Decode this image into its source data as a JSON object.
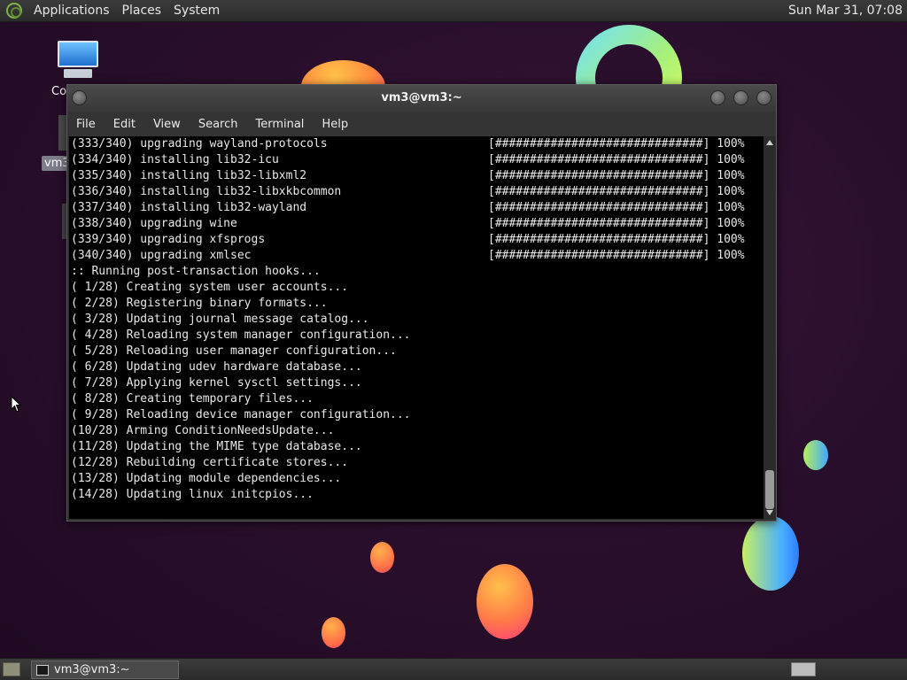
{
  "top_panel": {
    "menus": [
      "Applications",
      "Places",
      "System"
    ],
    "clock": "Sun Mar 31, 07:08"
  },
  "desktop": {
    "computer_label": "Co",
    "home_label": "vm3"
  },
  "terminal": {
    "title": "vm3@vm3:~",
    "menu": [
      "File",
      "Edit",
      "View",
      "Search",
      "Terminal",
      "Help"
    ],
    "lines": [
      {
        "text": "(333/340) upgrading wayland-protocols",
        "progress": "[##############################] 100%"
      },
      {
        "text": "(334/340) installing lib32-icu",
        "progress": "[##############################] 100%"
      },
      {
        "text": "(335/340) installing lib32-libxml2",
        "progress": "[##############################] 100%"
      },
      {
        "text": "(336/340) installing lib32-libxkbcommon",
        "progress": "[##############################] 100%"
      },
      {
        "text": "(337/340) installing lib32-wayland",
        "progress": "[##############################] 100%"
      },
      {
        "text": "(338/340) upgrading wine",
        "progress": "[##############################] 100%"
      },
      {
        "text": "(339/340) upgrading xfsprogs",
        "progress": "[##############################] 100%"
      },
      {
        "text": "(340/340) upgrading xmlsec",
        "progress": "[##############################] 100%"
      },
      {
        "text": ":: Running post-transaction hooks...",
        "progress": ""
      },
      {
        "text": "( 1/28) Creating system user accounts...",
        "progress": ""
      },
      {
        "text": "( 2/28) Registering binary formats...",
        "progress": ""
      },
      {
        "text": "( 3/28) Updating journal message catalog...",
        "progress": ""
      },
      {
        "text": "( 4/28) Reloading system manager configuration...",
        "progress": ""
      },
      {
        "text": "( 5/28) Reloading user manager configuration...",
        "progress": ""
      },
      {
        "text": "( 6/28) Updating udev hardware database...",
        "progress": ""
      },
      {
        "text": "( 7/28) Applying kernel sysctl settings...",
        "progress": ""
      },
      {
        "text": "( 8/28) Creating temporary files...",
        "progress": ""
      },
      {
        "text": "( 9/28) Reloading device manager configuration...",
        "progress": ""
      },
      {
        "text": "(10/28) Arming ConditionNeedsUpdate...",
        "progress": ""
      },
      {
        "text": "(11/28) Updating the MIME type database...",
        "progress": ""
      },
      {
        "text": "(12/28) Rebuilding certificate stores...",
        "progress": ""
      },
      {
        "text": "(13/28) Updating module dependencies...",
        "progress": ""
      },
      {
        "text": "(14/28) Updating linux initcpios...",
        "progress": ""
      }
    ]
  },
  "taskbar": {
    "items": [
      {
        "label": "vm3@vm3:~"
      }
    ]
  },
  "icons": {
    "logo": "distro-logo-icon",
    "computer": "computer-icon",
    "window_menu": "window-menu-icon",
    "terminal_task": "terminal-icon"
  }
}
